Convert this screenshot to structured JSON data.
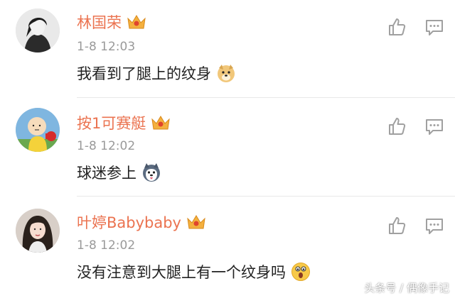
{
  "comments": [
    {
      "username": "林国荣",
      "time": "1-8 12:03",
      "text": "我看到了腿上的纹身",
      "emoji": "doge-emoji"
    },
    {
      "username": "按1可赛艇",
      "time": "1-8 12:02",
      "text": "球迷参上",
      "emoji": "husky-emoji"
    },
    {
      "username": "叶婷Babybaby",
      "time": "1-8 12:02",
      "text": "没有注意到大腿上有一个纹身吗",
      "emoji": "surprised-emoji"
    }
  ],
  "watermark": "头条号 / 偶像手记",
  "colors": {
    "username": "#eb7350",
    "time": "#9a9a9a",
    "text": "#222222",
    "icon": "#a0a0a0",
    "crown": "#f4b03e"
  }
}
